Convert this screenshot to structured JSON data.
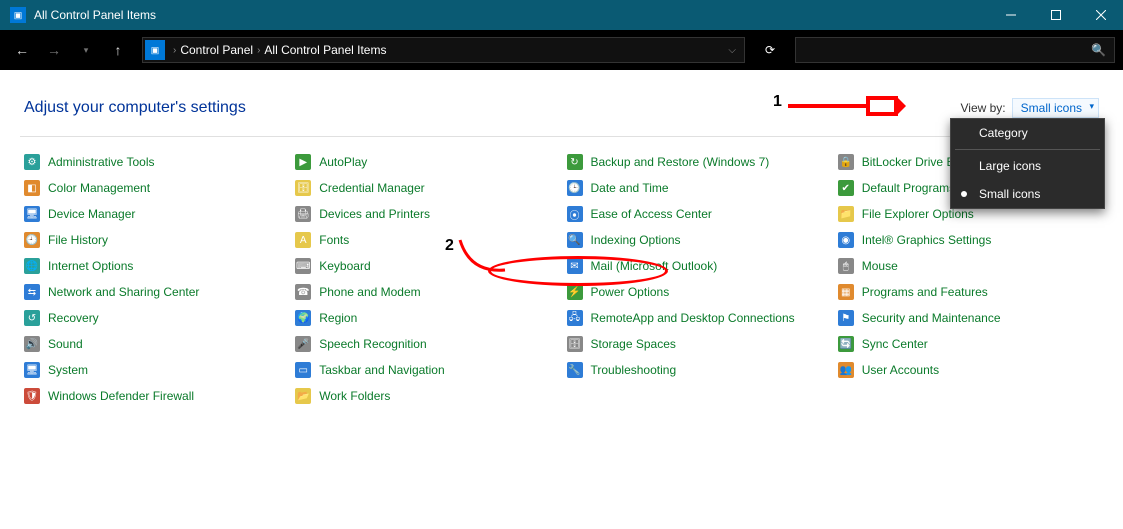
{
  "window": {
    "title": "All Control Panel Items"
  },
  "breadcrumb": {
    "root": "Control Panel",
    "current": "All Control Panel Items"
  },
  "heading": "Adjust your computer's settings",
  "viewby": {
    "label": "View by:",
    "value": "Small icons"
  },
  "dropdown": {
    "cat": "Category",
    "large": "Large icons",
    "small": "Small icons"
  },
  "annotations": {
    "one": "1",
    "two": "2"
  },
  "items": {
    "c0r0": "Administrative Tools",
    "c0r1": "Color Management",
    "c0r2": "Device Manager",
    "c0r3": "File History",
    "c0r4": "Internet Options",
    "c0r5": "Network and Sharing Center",
    "c0r6": "Recovery",
    "c0r7": "Sound",
    "c0r8": "System",
    "c0r9": "Windows Defender Firewall",
    "c1r0": "AutoPlay",
    "c1r1": "Credential Manager",
    "c1r2": "Devices and Printers",
    "c1r3": "Fonts",
    "c1r4": "Keyboard",
    "c1r5": "Phone and Modem",
    "c1r6": "Region",
    "c1r7": "Speech Recognition",
    "c1r8": "Taskbar and Navigation",
    "c1r9": "Work Folders",
    "c2r0": "Backup and Restore (Windows 7)",
    "c2r1": "Date and Time",
    "c2r2": "Ease of Access Center",
    "c2r3": "Indexing Options",
    "c2r4": "Mail (Microsoft Outlook)",
    "c2r5": "Power Options",
    "c2r6": "RemoteApp and Desktop Connections",
    "c2r7": "Storage Spaces",
    "c2r8": "Troubleshooting",
    "c3r0": "BitLocker Drive Encryption",
    "c3r1": "Default Programs",
    "c3r2": "File Explorer Options",
    "c3r3": "Intel® Graphics Settings",
    "c3r4": "Mouse",
    "c3r5": "Programs and Features",
    "c3r6": "Security and Maintenance",
    "c3r7": "Sync Center",
    "c3r8": "User Accounts"
  }
}
